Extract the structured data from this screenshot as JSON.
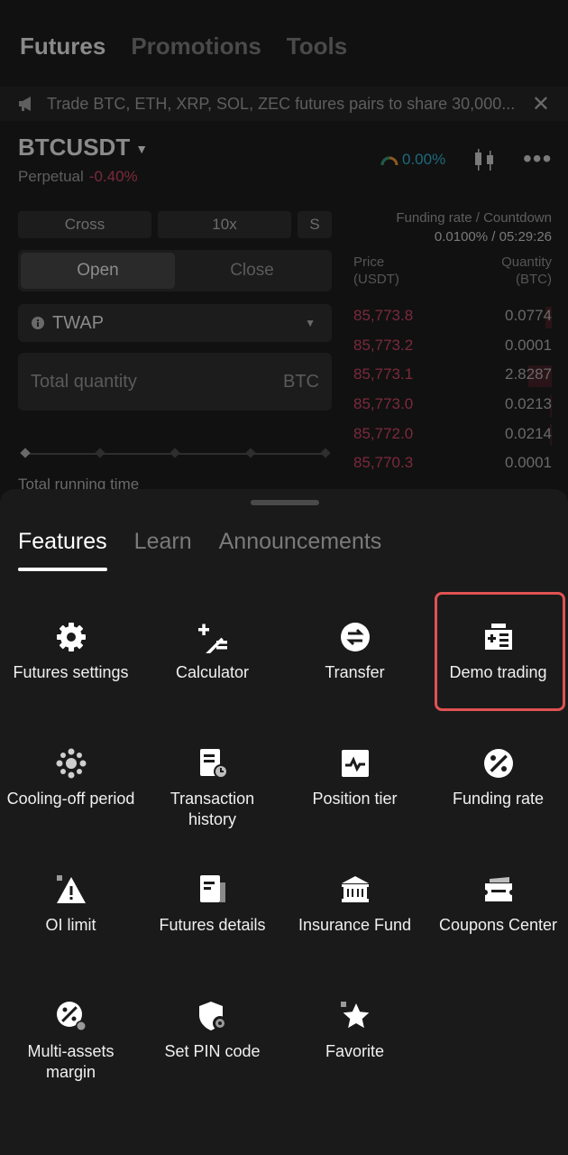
{
  "nav": {
    "tabs": [
      "Futures",
      "Promotions",
      "Tools"
    ],
    "active": 0
  },
  "banner": {
    "text": "Trade BTC, ETH, XRP, SOL, ZEC futures pairs to share 30,000...",
    "close_icon": "close-icon"
  },
  "symbol": {
    "name": "BTCUSDT",
    "type": "Perpetual",
    "change": "-0.40%",
    "sentiment": "0.00%"
  },
  "order": {
    "margin_mode": "Cross",
    "leverage": "10x",
    "side_short": "S",
    "open_label": "Open",
    "close_label": "Close",
    "order_type": "TWAP",
    "qty_placeholder": "Total quantity",
    "qty_unit": "BTC",
    "running_label": "Total running time"
  },
  "funding": {
    "label": "Funding rate / Countdown",
    "value": "0.0100% / 05:29:26"
  },
  "orderbook": {
    "price_header": "Price",
    "price_unit": "(USDT)",
    "qty_header": "Quantity",
    "qty_unit": "(BTC)",
    "rows": [
      {
        "price": "85,773.8",
        "qty": "0.0774",
        "depth": 0.03
      },
      {
        "price": "85,773.2",
        "qty": "0.0001",
        "depth": 0.0
      },
      {
        "price": "85,773.1",
        "qty": "2.8287",
        "depth": 0.12
      },
      {
        "price": "85,773.0",
        "qty": "0.0213",
        "depth": 0.01
      },
      {
        "price": "85,772.0",
        "qty": "0.0214",
        "depth": 0.01
      },
      {
        "price": "85,770.3",
        "qty": "0.0001",
        "depth": 0.0
      }
    ]
  },
  "sheet": {
    "tabs": [
      "Features",
      "Learn",
      "Announcements"
    ],
    "active_tab": 0,
    "items": [
      {
        "label": "Futures settings",
        "icon": "gear-icon"
      },
      {
        "label": "Calculator",
        "icon": "calculator-icon"
      },
      {
        "label": "Transfer",
        "icon": "transfer-icon"
      },
      {
        "label": "Demo trading",
        "icon": "demo-trading-icon"
      },
      {
        "label": "Cooling-off period",
        "icon": "cooling-off-icon"
      },
      {
        "label": "Transaction history",
        "icon": "transaction-history-icon"
      },
      {
        "label": "Position tier",
        "icon": "position-tier-icon"
      },
      {
        "label": "Funding rate",
        "icon": "funding-rate-icon"
      },
      {
        "label": "OI limit",
        "icon": "warning-icon"
      },
      {
        "label": "Futures details",
        "icon": "document-icon"
      },
      {
        "label": "Insurance Fund",
        "icon": "bank-icon"
      },
      {
        "label": "Coupons Center",
        "icon": "coupon-icon"
      },
      {
        "label": "Multi-assets margin",
        "icon": "multi-assets-icon"
      },
      {
        "label": "Set PIN code",
        "icon": "shield-gear-icon"
      },
      {
        "label": "Favorite",
        "icon": "star-icon"
      }
    ],
    "highlight_color": "#e05252"
  }
}
